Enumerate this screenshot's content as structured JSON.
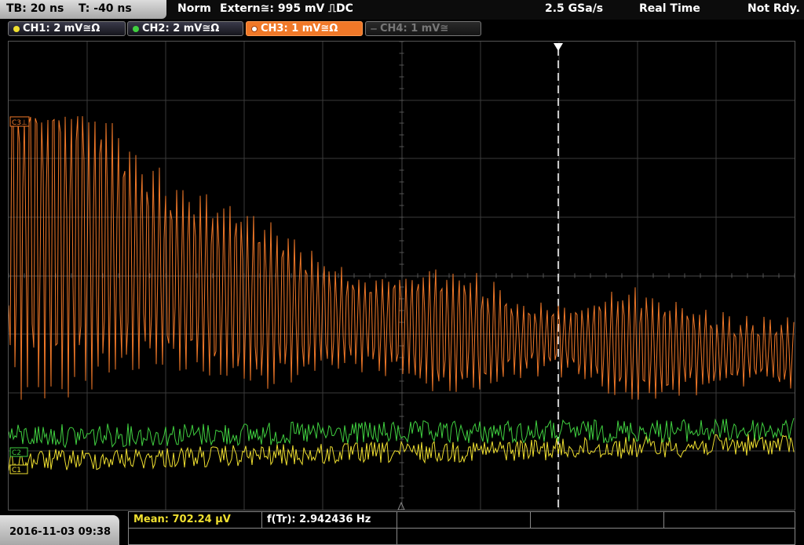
{
  "header": {
    "timebase": "TB: 20 ns",
    "trigger_time": "T: -40 ns",
    "trigger_mode": "Norm",
    "trigger_source": "Extern≅: 995 mV ⎍DC",
    "sample_rate": "2.5 GSa/s",
    "acq_mode": "Real Time",
    "status": "Not Rdy."
  },
  "channels": [
    {
      "label": "CH1: 2 mV≅Ω",
      "color": "#f0e030",
      "active": false,
      "enabled": true
    },
    {
      "label": "CH2: 2 mV≅Ω",
      "color": "#40d040",
      "active": false,
      "enabled": true
    },
    {
      "label": "CH3: 1 mV≅Ω",
      "color": "#f07828",
      "active": true,
      "enabled": true
    },
    {
      "label": "CH4: 1 mV≅",
      "color": "#666666",
      "active": false,
      "enabled": false
    }
  ],
  "markers": {
    "ch3": "C3⊥",
    "ch2": "C2",
    "ch1": "C1"
  },
  "footer": {
    "datetime": "2016-11-03 09:38",
    "mean": "Mean: 702.24 µV",
    "frequency": "f(Tr): 2.942436 Hz"
  },
  "colors": {
    "ch1": "#f0e030",
    "ch2": "#40d040",
    "ch3": "#f07828",
    "grid": "#3a3a3a"
  }
}
